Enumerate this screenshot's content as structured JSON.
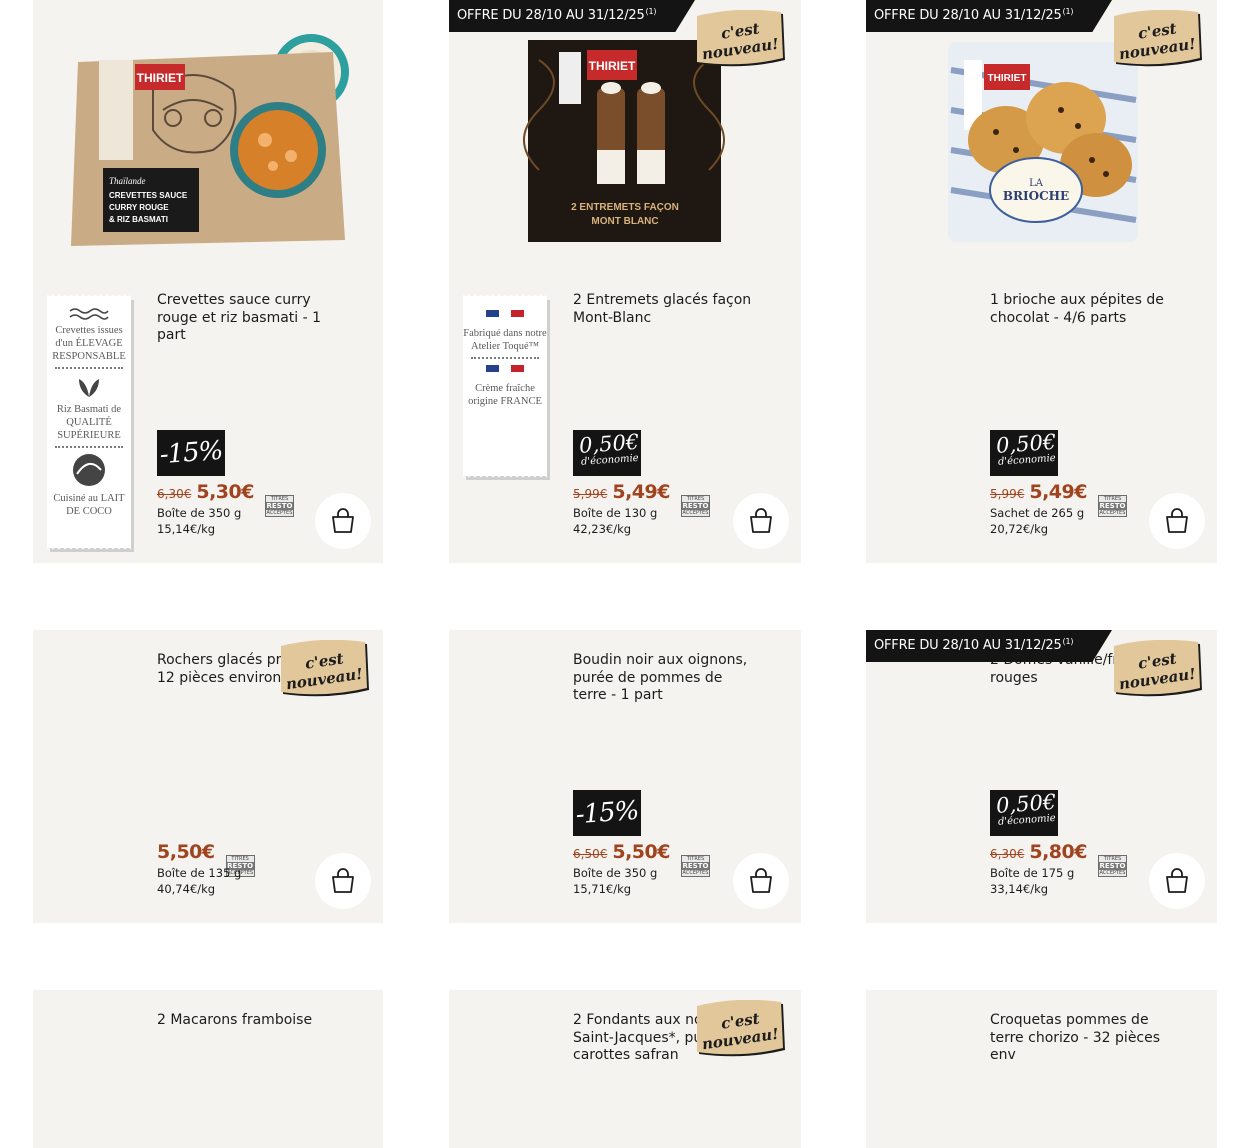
{
  "offer_banner": {
    "text": "OFFRE DU 28/10 AU 31/12/25",
    "note": "(1)"
  },
  "badge_new": {
    "line1": "c'est",
    "line2": "nouveau!"
  },
  "tr_logo": {
    "line1": "TITRES",
    "line2": "RESTO",
    "line3": "ACCEPTÉS"
  },
  "products": [
    {
      "title": "Crevettes sauce curry rouge et riz basmati - 1 part",
      "promo": "-15%",
      "old_price": "6,30€",
      "price": "5,30€",
      "pack": "Boîte de 350 g",
      "unit_price": "15,14€/kg",
      "labels": [
        {
          "icon": "wave-icon",
          "text": "Crevettes issues d'un ÉLEVAGE RESPONSABLE"
        },
        {
          "icon": "leaf-icon",
          "text": "Riz Basmati de QUALITÉ SUPÉRIEURE"
        },
        {
          "icon": "coconut-icon",
          "text": "Cuisiné au LAIT DE COCO"
        }
      ]
    },
    {
      "title": "2 Entremets glacés façon Mont-Blanc",
      "promo_value": "0,50€",
      "promo_text": "d'économie",
      "old_price": "5,99€",
      "price": "5,49€",
      "pack": "Boîte de 130 g",
      "unit_price": "42,23€/kg",
      "labels": [
        {
          "icon": "flag-fr-icon",
          "text": "Fabriqué dans notre Atelier Toqué™"
        },
        {
          "icon": "flag-fr-icon",
          "text": "Crème fraîche origine FRANCE"
        }
      ]
    },
    {
      "title": "1 brioche aux pépites de chocolat - 4/6 parts",
      "promo_value": "0,50€",
      "promo_text": "d'économie",
      "old_price": "5,99€",
      "price": "5,49€",
      "pack": "Sachet de 265 g",
      "unit_price": "20,72€/kg"
    },
    {
      "title": "Rochers glacés praliné - 12 pièces environ",
      "price": "5,50€",
      "pack": "Boîte de 135 g",
      "unit_price": "40,74€/kg"
    },
    {
      "title": "Boudin noir aux oignons, purée de pommes de terre - 1 part",
      "promo": "-15%",
      "old_price": "6,50€",
      "price": "5,50€",
      "pack": "Boîte de 350 g",
      "unit_price": "15,71€/kg"
    },
    {
      "title": "2 Dômes vanille/fruits rouges",
      "promo_value": "0,50€",
      "promo_text": "d'économie",
      "old_price": "6,30€",
      "price": "5,80€",
      "pack": "Boîte de 175 g",
      "unit_price": "33,14€/kg"
    },
    {
      "title": "2 Macarons framboise"
    },
    {
      "title": "2 Fondants aux noix de Saint-Jacques*, purée de carottes safran"
    },
    {
      "title": "Croquetas pommes de terre chorizo - 32 pièces env"
    }
  ],
  "images": {
    "p1": {
      "brand": "THIRIET",
      "line1": "Thaïlande",
      "line2": "CREVETTES SAUCE",
      "line3": "CURRY ROUGE",
      "line4": "& RIZ BASMATI"
    },
    "p2": {
      "brand": "THIRIET",
      "line1": "2 ENTREMETS FAÇON",
      "line2": "MONT BLANC"
    },
    "p3": {
      "brand": "THIRIET",
      "line1": "LA",
      "line2": "BRIOCHE"
    }
  },
  "colors": {
    "card_bg": "#f5f3ef",
    "price": "#a0431f",
    "banner": "#141414",
    "badge": "#e2c79b"
  }
}
